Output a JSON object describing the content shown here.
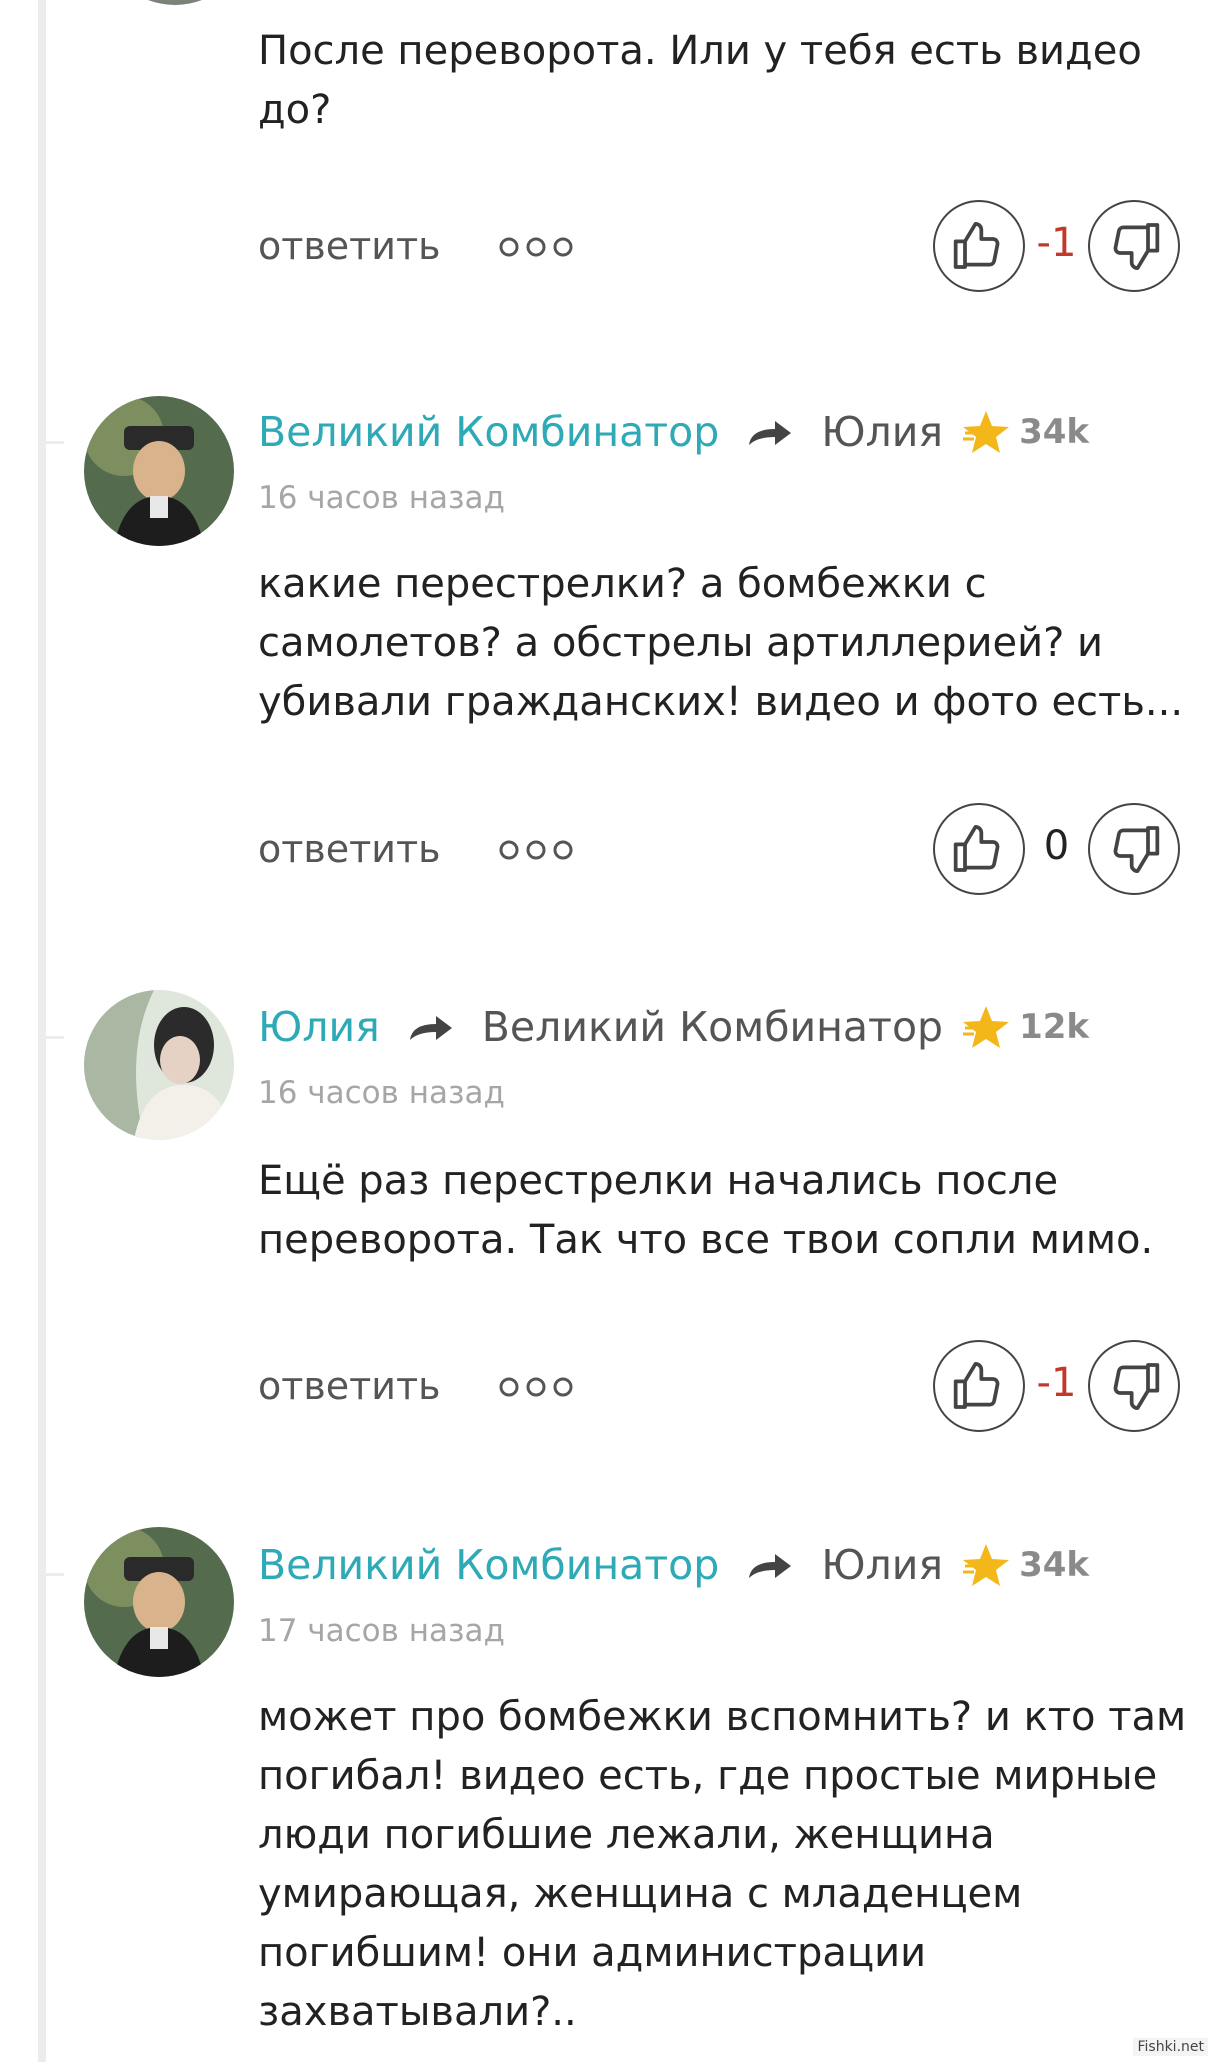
{
  "colors": {
    "author": "#2eaab7",
    "negative_score": "#c0392b",
    "star": "#f4b71a",
    "thread_line": "#ececec"
  },
  "icons": {
    "reply_arrow": "share-arrow-icon",
    "rating": "star-icon",
    "like": "thumbs-up-icon",
    "dislike": "thumbs-down-icon",
    "more": "more-dots-icon"
  },
  "comments": [
    {
      "text": "После переворота. Или у тебя есть видео до?",
      "actions": {
        "reply_label": "ответить",
        "score": "-1"
      }
    },
    {
      "author": "Великий Комбинатор",
      "reply_to": "Юлия",
      "rating": "34k",
      "time": "16 часов назад",
      "text": "какие перестрелки? а бомбежки с самолетов? а обстрелы артиллерией? и убивали гражданских! видео и фото есть...",
      "actions": {
        "reply_label": "ответить",
        "score": "0"
      }
    },
    {
      "author": "Юлия",
      "reply_to": "Великий Комбинатор",
      "rating": "12k",
      "time": "16 часов назад",
      "text": "Ещё раз перестрелки начались после переворота. Так что все твои сопли мимо.",
      "actions": {
        "reply_label": "ответить",
        "score": "-1"
      }
    },
    {
      "author": "Великий Комбинатор",
      "reply_to": "Юлия",
      "rating": "34k",
      "time": "17 часов назад",
      "text": "может про бомбежки вспомнить? и кто там погибал! видео есть, где простые мирные люди погибшие лежали, женщина умирающая, женщина с младенцем погибшим! они администрации захватывали?.."
    }
  ],
  "watermark": "Fishki.net"
}
